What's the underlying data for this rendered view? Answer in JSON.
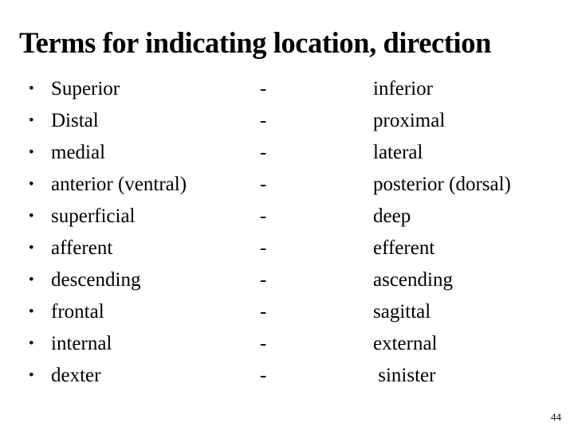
{
  "slide": {
    "title": "Terms for indicating location, direction",
    "bullet_glyph": "•",
    "page_number": "44",
    "rows": [
      {
        "left": "Superior",
        "separator": "-",
        "right": "inferior"
      },
      {
        "left": "Distal",
        "separator": "-",
        "right": "proximal"
      },
      {
        "left": "medial",
        "separator": "-",
        "right": "lateral"
      },
      {
        "left": "anterior (ventral)",
        "separator": "-",
        "right": "posterior (dorsal)"
      },
      {
        "left": "superficial",
        "separator": "-",
        "right": "deep"
      },
      {
        "left": "afferent",
        "separator": "-",
        "right": "efferent"
      },
      {
        "left": "descending",
        "separator": "-",
        "right": "ascending"
      },
      {
        "left": "frontal",
        "separator": "-",
        "right": "sagittal"
      },
      {
        "left": "internal",
        "separator": "-",
        "right": "external"
      },
      {
        "left": "dexter",
        "separator": "-",
        "right": " sinister"
      }
    ]
  }
}
